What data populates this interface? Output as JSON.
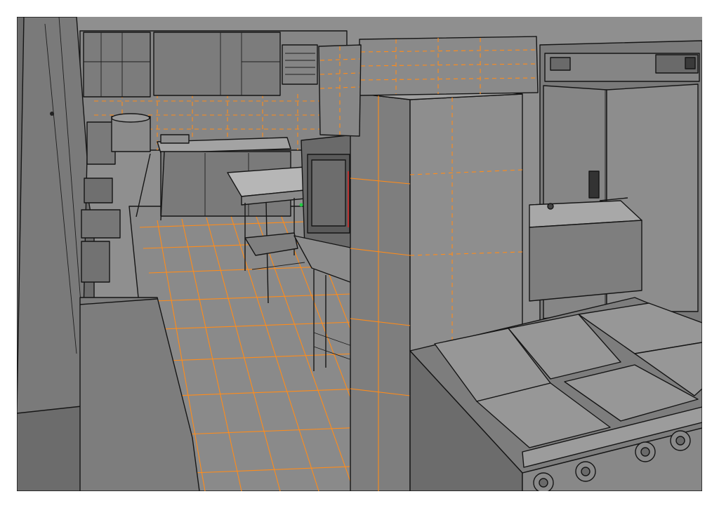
{
  "viewport": {
    "name": "3d-modeling-viewport",
    "scene": "commercial-kitchen-wireframe",
    "colors": {
      "background_frame": "#ffffff",
      "ceiling": "#8f8f8f",
      "surface": "#828282",
      "surface_light": "#9a9a9a",
      "surface_dark": "#5e5e5e",
      "edge": "#151515",
      "selection_edge": "#ff8c1a",
      "highlight_point": "#22cc44"
    },
    "icons": [
      "selection-wireframe",
      "grid-tiles"
    ]
  }
}
